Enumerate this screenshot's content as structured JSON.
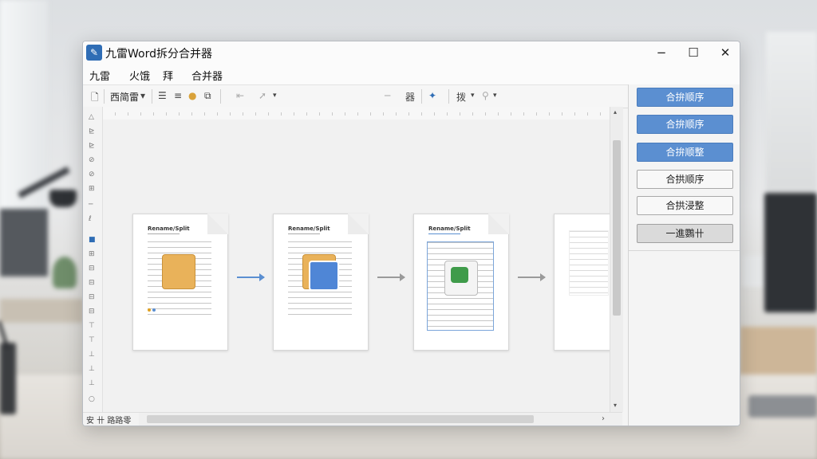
{
  "window": {
    "title": "九雷Word拆分合并器",
    "controls": {
      "minimize": "−",
      "maximize": "☐",
      "close": "✕"
    }
  },
  "menu": [
    "九雷",
    "火饿",
    "拜",
    "合并器"
  ],
  "toolbar": {
    "new_glyph": "🗋",
    "style_dropdown": "西简雷",
    "chevron": "▾",
    "divider_glyph": "─",
    "grid_glyph": "器",
    "find_glyph": "拨"
  },
  "flow": {
    "doc_titles": [
      "Rename/Split",
      "Rename/Split",
      "Rename/Split"
    ],
    "arrow_colors": [
      "#5b8fd1",
      "#9a9a9a",
      "#9a9a9a"
    ]
  },
  "statusbar": {
    "text": "安 卄 路路零"
  },
  "scrollbar": {
    "down": "▾",
    "up": "▴",
    "right": "›"
  },
  "right_panel": {
    "buttons": [
      {
        "label": "合拚顺序",
        "style": "blue"
      },
      {
        "label": "合拚顺序",
        "style": "blue"
      },
      {
        "label": "合拚顺整",
        "style": "blue"
      },
      {
        "label": "合拱顺序",
        "style": "plain"
      },
      {
        "label": "合拱浸整",
        "style": "plain"
      },
      {
        "label": "一進鸚卄",
        "style": "gray"
      }
    ]
  },
  "colors": {
    "accent": "#5b8fd1",
    "title_blue": "#2f6db5"
  }
}
